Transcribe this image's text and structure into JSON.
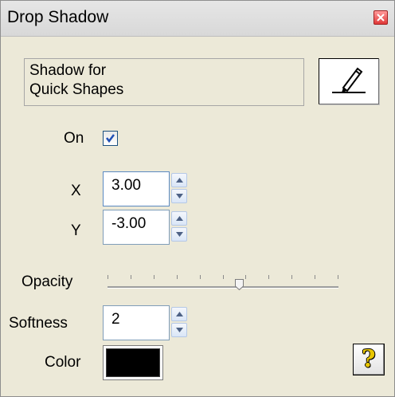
{
  "window": {
    "title": "Drop Shadow"
  },
  "description": {
    "line1": "Shadow for",
    "line2": "Quick Shapes"
  },
  "tool_icon": "pen-icon",
  "on_toggle": {
    "label": "On",
    "checked": true
  },
  "offset": {
    "x_label": "X",
    "x_value": "3.00",
    "y_label": "Y",
    "y_value": "-3.00"
  },
  "opacity": {
    "label": "Opacity",
    "level": 0.57,
    "tick_count": 10
  },
  "softness": {
    "label": "Softness",
    "value": "2"
  },
  "color": {
    "label": "Color",
    "value": "#000000"
  },
  "help": {
    "glyph": "?"
  }
}
